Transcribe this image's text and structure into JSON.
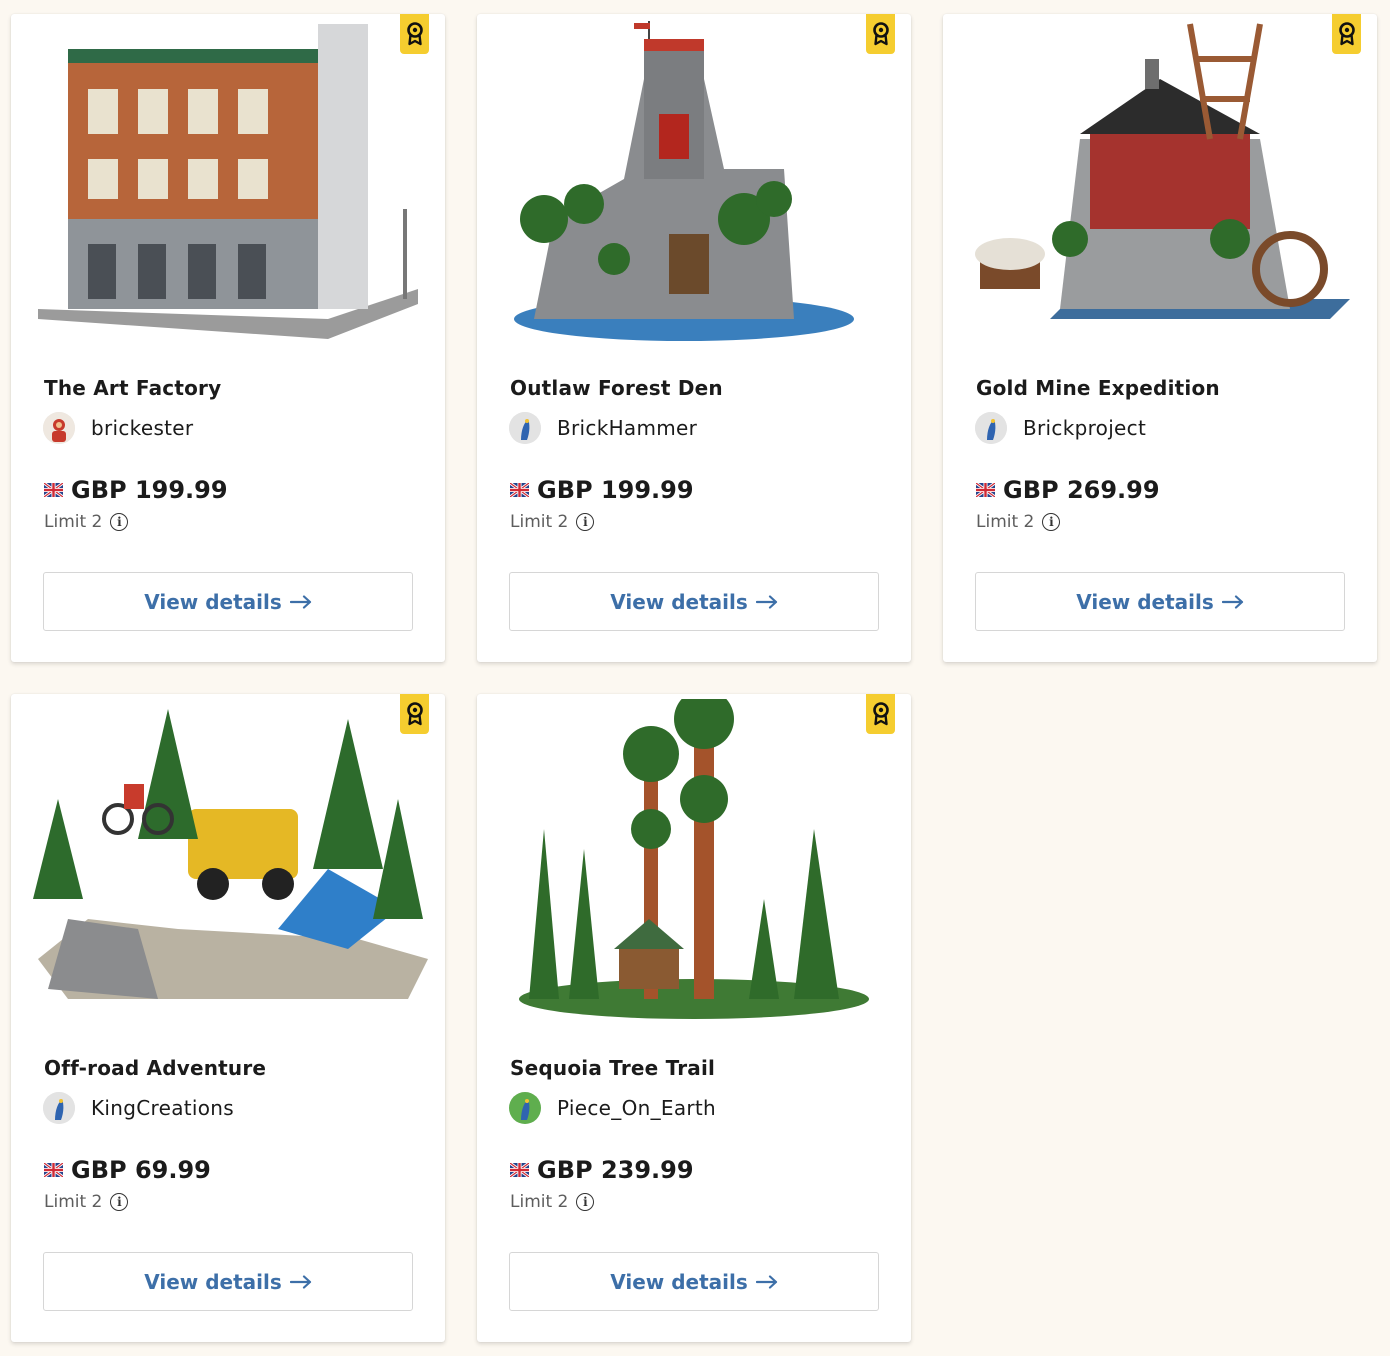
{
  "products": [
    {
      "title": "The Art Factory",
      "author": "brickester",
      "price": "GBP 199.99",
      "limit": "Limit 2",
      "cta": "View details"
    },
    {
      "title": "Outlaw Forest Den",
      "author": "BrickHammer",
      "price": "GBP 199.99",
      "limit": "Limit 2",
      "cta": "View details"
    },
    {
      "title": "Gold Mine Expedition",
      "author": "Brickproject",
      "price": "GBP 269.99",
      "limit": "Limit 2",
      "cta": "View details"
    },
    {
      "title": "Off-road Adventure",
      "author": "KingCreations",
      "price": "GBP 69.99",
      "limit": "Limit 2",
      "cta": "View details"
    },
    {
      "title": "Sequoia Tree Trail",
      "author": "Piece_On_Earth",
      "price": "GBP 239.99",
      "limit": "Limit 2",
      "cta": "View details"
    }
  ],
  "colors": {
    "background": "#fcf8f1",
    "card": "#ffffff",
    "badge": "#f5cd2f",
    "link": "#3d6fa8"
  }
}
